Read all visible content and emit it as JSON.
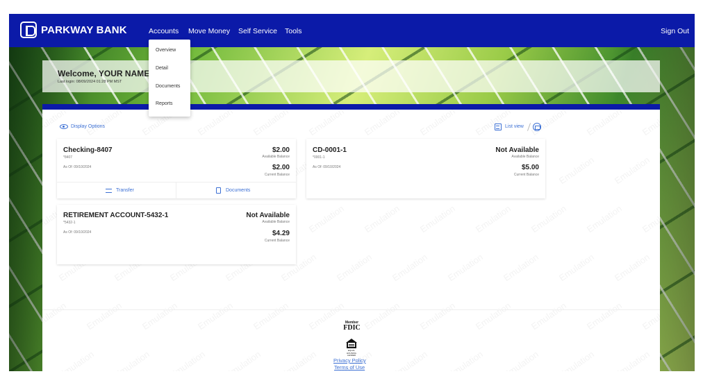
{
  "header": {
    "brand": "PARKWAY BANK",
    "nav": [
      "Accounts",
      "Move Money",
      "Self Service",
      "Tools"
    ],
    "sign_out": "Sign Out"
  },
  "accounts_menu": {
    "items": [
      "Overview",
      "Detail",
      "Documents",
      "Reports"
    ]
  },
  "welcome": {
    "title": "Welcome, YOUR NAME",
    "last_login": "Last login: 08/09/2024 01:28 PM MST"
  },
  "toolbar": {
    "display_options": "Display Options",
    "list_view": "List view"
  },
  "accounts": [
    {
      "name": "Checking-8407",
      "number": "*8407",
      "as_of": "As Of: 09/10/2024",
      "available_balance": "$2.00",
      "available_label": "Available Balance",
      "current_balance": "$2.00",
      "current_label": "Current Balance",
      "actions": [
        "Transfer",
        "Documents"
      ]
    },
    {
      "name": "CD-0001-1",
      "number": "*0001-1",
      "as_of": "As Of: 09/10/2024",
      "available_balance": "Not Available",
      "available_label": "Available Balance",
      "current_balance": "$5.00",
      "current_label": "Current Balance"
    },
    {
      "name": "RETIREMENT ACCOUNT-5432-1",
      "number": "*5432-1",
      "as_of": "As Of: 09/10/2024",
      "available_balance": "Not Available",
      "available_label": "Available Balance",
      "current_balance": "$4.29",
      "current_label": "Current Balance"
    }
  ],
  "footer": {
    "fdic_top": "Member",
    "fdic_main": "FDIC",
    "ehl_text": "EQUAL HOUSING LENDER",
    "privacy": "Privacy Policy",
    "terms": "Terms of Use"
  },
  "watermark_text": "Emulation",
  "colors": {
    "brand_blue": "#0b1aa8",
    "link_blue": "#3b6fd4"
  }
}
